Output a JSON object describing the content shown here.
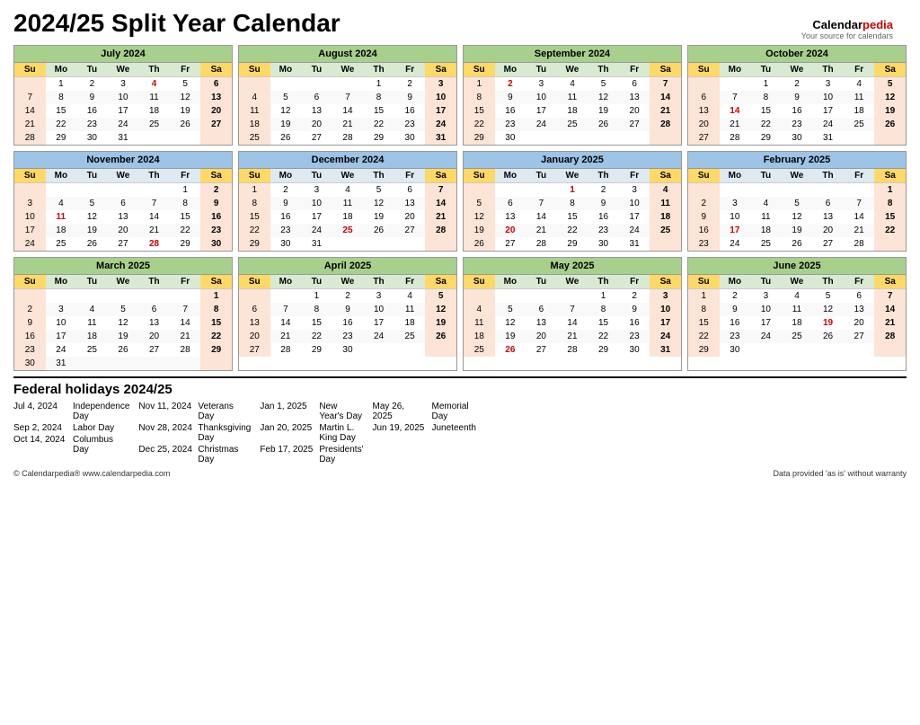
{
  "title": "2024/25 Split Year Calendar",
  "brand": {
    "name1": "Calendar",
    "name2": "pedia",
    "tagline": "Your source for calendars"
  },
  "months": [
    {
      "name": "July 2024",
      "style": "green",
      "days": [
        [
          "",
          "1",
          "2",
          "3",
          "4*",
          "5",
          "6"
        ],
        [
          "7",
          "8",
          "9",
          "10",
          "11",
          "12",
          "13"
        ],
        [
          "14",
          "15",
          "16",
          "17",
          "18",
          "19",
          "20"
        ],
        [
          "21",
          "22",
          "23",
          "24",
          "25",
          "26",
          "27"
        ],
        [
          "28",
          "29",
          "30",
          "31",
          "",
          "",
          ""
        ]
      ],
      "holidays": {
        "4": true
      }
    },
    {
      "name": "August 2024",
      "style": "green",
      "days": [
        [
          "",
          "",
          "",
          "",
          "1",
          "2",
          "3"
        ],
        [
          "4",
          "5",
          "6",
          "7",
          "8",
          "9",
          "10"
        ],
        [
          "11",
          "12",
          "13",
          "14",
          "15",
          "16",
          "17"
        ],
        [
          "18",
          "19",
          "20",
          "21",
          "22",
          "23",
          "24"
        ],
        [
          "25",
          "26",
          "27",
          "28",
          "29",
          "30",
          "31"
        ]
      ],
      "holidays": {}
    },
    {
      "name": "September 2024",
      "style": "green",
      "days": [
        [
          "1",
          "2*",
          "3",
          "4",
          "5",
          "6",
          "7"
        ],
        [
          "8",
          "9",
          "10",
          "11",
          "12",
          "13",
          "14"
        ],
        [
          "15",
          "16",
          "17",
          "18",
          "19",
          "20",
          "21"
        ],
        [
          "22",
          "23",
          "24",
          "25",
          "26",
          "27",
          "28"
        ],
        [
          "29",
          "30",
          "",
          "",
          "",
          "",
          ""
        ]
      ],
      "holidays": {
        "2": true
      }
    },
    {
      "name": "October 2024",
      "style": "green",
      "days": [
        [
          "",
          "",
          "1",
          "2",
          "3",
          "4",
          "5"
        ],
        [
          "6",
          "7",
          "8",
          "9",
          "10",
          "11",
          "12"
        ],
        [
          "13",
          "14*",
          "15",
          "16",
          "17",
          "18",
          "19"
        ],
        [
          "20",
          "21",
          "22",
          "23",
          "24",
          "25",
          "26"
        ],
        [
          "27",
          "28",
          "29",
          "30",
          "31",
          "",
          ""
        ]
      ],
      "holidays": {
        "14": true
      }
    },
    {
      "name": "November 2024",
      "style": "blue",
      "days": [
        [
          "",
          "",
          "",
          "",
          "",
          "1",
          "2"
        ],
        [
          "3",
          "4",
          "5",
          "6",
          "7",
          "8",
          "9"
        ],
        [
          "10",
          "11*",
          "12",
          "13",
          "14",
          "15",
          "16"
        ],
        [
          "17",
          "18",
          "19",
          "20",
          "21",
          "22",
          "23"
        ],
        [
          "24",
          "25",
          "26",
          "27",
          "28*",
          "29",
          "30"
        ]
      ],
      "holidays": {
        "11": true,
        "28": true
      }
    },
    {
      "name": "December 2024",
      "style": "blue",
      "days": [
        [
          "1",
          "2",
          "3",
          "4",
          "5",
          "6",
          "7"
        ],
        [
          "8",
          "9",
          "10",
          "11",
          "12",
          "13",
          "14"
        ],
        [
          "15",
          "16",
          "17",
          "18",
          "19",
          "20",
          "21"
        ],
        [
          "22",
          "23",
          "24",
          "25*",
          "26",
          "27",
          "28"
        ],
        [
          "29",
          "30",
          "31",
          "",
          "",
          "",
          ""
        ]
      ],
      "holidays": {
        "25": true
      }
    },
    {
      "name": "January 2025",
      "style": "blue",
      "days": [
        [
          "",
          "",
          "",
          "1*",
          "2",
          "3",
          "4"
        ],
        [
          "5",
          "6",
          "7",
          "8",
          "9",
          "10",
          "11"
        ],
        [
          "12",
          "13",
          "14",
          "15",
          "16",
          "17",
          "18"
        ],
        [
          "19",
          "20*",
          "21",
          "22",
          "23",
          "24",
          "25"
        ],
        [
          "26",
          "27",
          "28",
          "29",
          "30",
          "31",
          ""
        ]
      ],
      "holidays": {
        "1": true,
        "20": true
      }
    },
    {
      "name": "February 2025",
      "style": "blue",
      "days": [
        [
          "",
          "",
          "",
          "",
          "",
          "",
          "1"
        ],
        [
          "2",
          "3",
          "4",
          "5",
          "6",
          "7",
          "8"
        ],
        [
          "9",
          "10",
          "11",
          "12",
          "13",
          "14",
          "15"
        ],
        [
          "16",
          "17*",
          "18",
          "19",
          "20",
          "21",
          "22"
        ],
        [
          "23",
          "24",
          "25",
          "26",
          "27",
          "28",
          ""
        ]
      ],
      "holidays": {
        "17": true
      }
    },
    {
      "name": "March 2025",
      "style": "green",
      "days": [
        [
          "",
          "",
          "",
          "",
          "",
          "",
          "1"
        ],
        [
          "2",
          "3",
          "4",
          "5",
          "6",
          "7",
          "8"
        ],
        [
          "9",
          "10",
          "11",
          "12",
          "13",
          "14",
          "15"
        ],
        [
          "16",
          "17",
          "18",
          "19",
          "20",
          "21",
          "22"
        ],
        [
          "23",
          "24",
          "25",
          "26",
          "27",
          "28",
          "29"
        ],
        [
          "30",
          "31",
          "",
          "",
          "",
          "",
          ""
        ]
      ],
      "holidays": {}
    },
    {
      "name": "April 2025",
      "style": "green",
      "days": [
        [
          "",
          "",
          "1",
          "2",
          "3",
          "4",
          "5"
        ],
        [
          "6",
          "7",
          "8",
          "9",
          "10",
          "11",
          "12"
        ],
        [
          "13",
          "14",
          "15",
          "16",
          "17",
          "18",
          "19"
        ],
        [
          "20",
          "21",
          "22",
          "23",
          "24",
          "25",
          "26"
        ],
        [
          "27",
          "28",
          "29",
          "30",
          "",
          "",
          ""
        ]
      ],
      "holidays": {}
    },
    {
      "name": "May 2025",
      "style": "green",
      "days": [
        [
          "",
          "",
          "",
          "",
          "1",
          "2",
          "3"
        ],
        [
          "4",
          "5",
          "6",
          "7",
          "8",
          "9",
          "10"
        ],
        [
          "11",
          "12",
          "13",
          "14",
          "15",
          "16",
          "17"
        ],
        [
          "18",
          "19",
          "20",
          "21",
          "22",
          "23",
          "24"
        ],
        [
          "25",
          "26*",
          "27",
          "28",
          "29",
          "30",
          "31"
        ]
      ],
      "holidays": {
        "26": true
      }
    },
    {
      "name": "June 2025",
      "style": "green",
      "days": [
        [
          "1",
          "2",
          "3",
          "4",
          "5",
          "6",
          "7"
        ],
        [
          "8",
          "9",
          "10",
          "11",
          "12",
          "13",
          "14"
        ],
        [
          "15",
          "16",
          "17",
          "18",
          "19*",
          "20",
          "21"
        ],
        [
          "22",
          "23",
          "24",
          "25",
          "26",
          "27",
          "28"
        ],
        [
          "29",
          "30",
          "",
          "",
          "",
          "",
          ""
        ]
      ],
      "holidays": {
        "19": true
      }
    }
  ],
  "holidays": [
    {
      "date": "Jul 4, 2024",
      "name": "Independence Day"
    },
    {
      "date": "Sep 2, 2024",
      "name": "Labor Day"
    },
    {
      "date": "Oct 14, 2024",
      "name": "Columbus Day"
    },
    {
      "date": "Nov 11, 2024",
      "name": "Veterans Day"
    },
    {
      "date": "Nov 28, 2024",
      "name": "Thanksgiving Day"
    },
    {
      "date": "Dec 25, 2024",
      "name": "Christmas Day"
    },
    {
      "date": "Jan 1, 2025",
      "name": "New Year's Day"
    },
    {
      "date": "Jan 20, 2025",
      "name": "Martin L. King Day"
    },
    {
      "date": "Feb 17, 2025",
      "name": "Presidents' Day"
    },
    {
      "date": "May 26, 2025",
      "name": "Memorial Day"
    },
    {
      "date": "Jun 19, 2025",
      "name": "Juneteenth"
    }
  ],
  "footer": {
    "copyright": "© Calendarpedia®  www.calendarpedia.com",
    "disclaimer": "Data provided 'as is' without warranty"
  }
}
